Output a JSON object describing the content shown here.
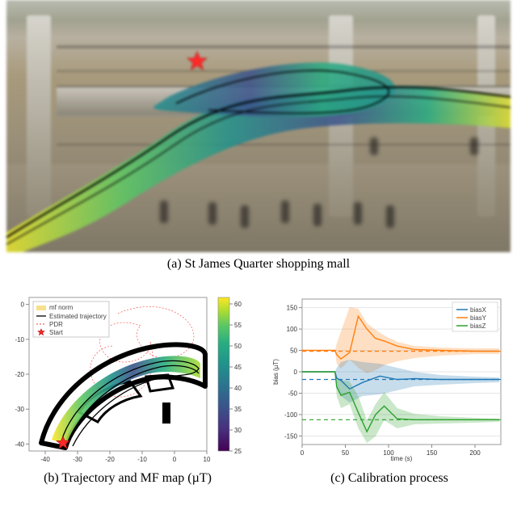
{
  "figure": {
    "top_caption": "(a) St James Quarter shopping mall",
    "bottom_left_caption": "(b) Trajectory and MF map (µT)",
    "bottom_right_caption": "(c) Calibration process"
  },
  "panel_b": {
    "legend": {
      "mf_norm": "mf norm",
      "estimated": "Estimated trajectory",
      "pdr": "PDR",
      "start": "Start"
    },
    "x_ticks": [
      -40,
      -30,
      -20,
      -10,
      0,
      10
    ],
    "y_ticks": [
      -40,
      -30,
      -20,
      -10,
      0
    ],
    "colorbar_ticks": [
      25,
      30,
      35,
      40,
      45,
      50,
      55,
      60
    ],
    "colorbar_unit": "µT"
  },
  "panel_c": {
    "xlabel": "time (s)",
    "ylabel": "bias (µT)",
    "legend": {
      "biasX": "biasX",
      "biasY": "biasY",
      "biasZ": "biasZ"
    },
    "x_ticks": [
      0,
      50,
      100,
      150,
      200
    ],
    "y_ticks": [
      -150,
      -100,
      -50,
      0,
      50,
      100,
      150
    ]
  },
  "chart_data": [
    {
      "id": "panel_b_colorbar",
      "type": "heatmap",
      "title": "MF norm colorbar",
      "ylim": [
        25,
        62
      ],
      "ticks": [
        25,
        30,
        35,
        40,
        45,
        50,
        55,
        60
      ],
      "colormap": "viridis"
    },
    {
      "id": "panel_b_map",
      "type": "scatter",
      "title": "Trajectory and MF map",
      "xlim": [
        -45,
        10
      ],
      "ylim": [
        -42,
        2
      ],
      "note": "Top-down floor map with estimated trajectory, PDR path, and MF-norm heat overlay; start near (-35,-39)."
    },
    {
      "id": "panel_c_calibration",
      "type": "line",
      "title": "Calibration process",
      "xlabel": "time (s)",
      "ylabel": "bias (µT)",
      "xlim": [
        0,
        230
      ],
      "ylim": [
        -170,
        170
      ],
      "series": [
        {
          "name": "biasX",
          "color": "#1f77b4",
          "final": -18,
          "x": [
            0,
            38,
            40,
            45,
            55,
            70,
            90,
            110,
            130,
            160,
            200,
            228
          ],
          "values": [
            0,
            0,
            -15,
            -20,
            -40,
            -25,
            -10,
            -18,
            -16,
            -18,
            -18,
            -18
          ]
        },
        {
          "name": "biasY",
          "color": "#ff7f0e",
          "final": 48,
          "x": [
            0,
            38,
            40,
            45,
            55,
            65,
            75,
            85,
            95,
            110,
            130,
            160,
            200,
            228
          ],
          "values": [
            50,
            50,
            40,
            30,
            45,
            130,
            100,
            78,
            72,
            60,
            52,
            50,
            48,
            48
          ]
        },
        {
          "name": "biasZ",
          "color": "#2ca02c",
          "final": -112,
          "x": [
            0,
            38,
            40,
            45,
            55,
            65,
            75,
            85,
            95,
            110,
            130,
            160,
            200,
            228
          ],
          "values": [
            0,
            0,
            -35,
            -55,
            -48,
            -95,
            -140,
            -100,
            -80,
            -110,
            -112,
            -112,
            -112,
            -112
          ]
        }
      ],
      "bands_note": "shaded uncertainty around each series"
    }
  ],
  "colors": {
    "viridis_stops": [
      "#440154",
      "#472f7d",
      "#3b528b",
      "#2c728e",
      "#21918c",
      "#27ad81",
      "#5cc863",
      "#aadc32",
      "#fde725"
    ],
    "biasX": "#1f77b4",
    "biasY": "#ff7f0e",
    "biasZ": "#2ca02c",
    "star": "#ff2a2a"
  }
}
